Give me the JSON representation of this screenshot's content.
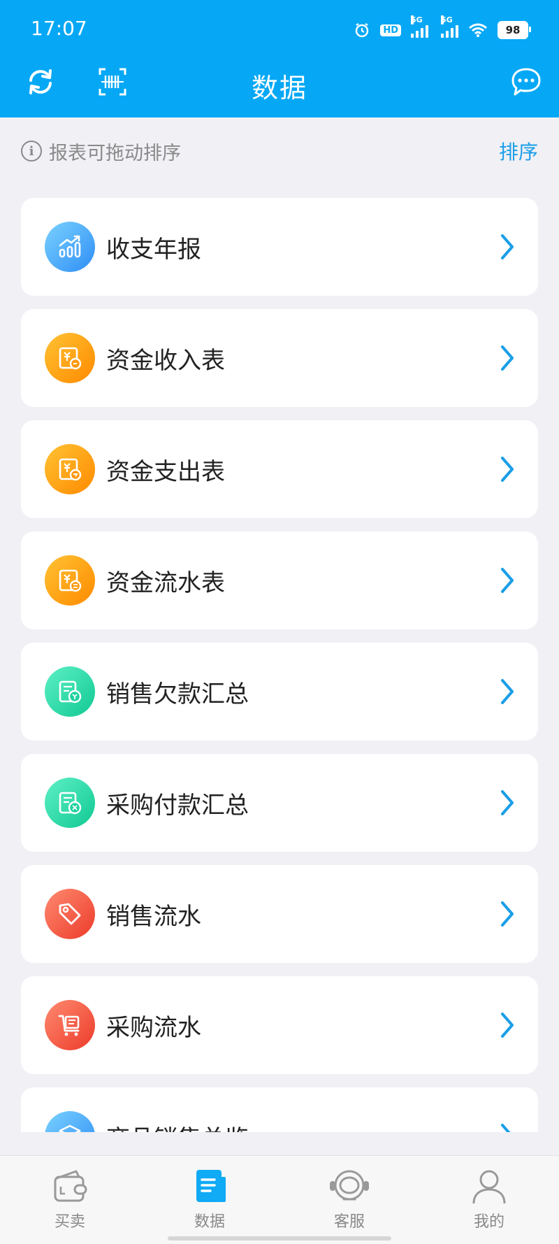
{
  "status_bar": {
    "time": "17:07",
    "hd": "HD",
    "net1": "5G",
    "net2": "5G",
    "battery": "98"
  },
  "header": {
    "title": "数据",
    "left_icon_1": "refresh-icon",
    "left_icon_2": "barcode-scan-icon",
    "right_icon": "message-icon"
  },
  "hint": {
    "text": "报表可拖动排序",
    "sort_label": "排序"
  },
  "reports": [
    {
      "label": "收支年报",
      "icon": "bar-chart-icon",
      "color": "blue"
    },
    {
      "label": "资金收入表",
      "icon": "income-report-icon",
      "color": "orange"
    },
    {
      "label": "资金支出表",
      "icon": "expense-report-icon",
      "color": "orange"
    },
    {
      "label": "资金流水表",
      "icon": "cashflow-report-icon",
      "color": "orange"
    },
    {
      "label": "销售欠款汇总",
      "icon": "sales-debt-icon",
      "color": "green"
    },
    {
      "label": "采购付款汇总",
      "icon": "purchase-payment-icon",
      "color": "green"
    },
    {
      "label": "销售流水",
      "icon": "price-tag-icon",
      "color": "red"
    },
    {
      "label": "采购流水",
      "icon": "shopping-cart-icon",
      "color": "red"
    },
    {
      "label": "商品销售总览",
      "icon": "box-icon",
      "color": "blue"
    }
  ],
  "bottom_nav": [
    {
      "label": "买卖",
      "icon": "wallet-icon"
    },
    {
      "label": "数据",
      "icon": "document-icon"
    },
    {
      "label": "客服",
      "icon": "headset-icon"
    },
    {
      "label": "我的",
      "icon": "user-icon"
    }
  ],
  "colors": {
    "primary": "#06a8f5",
    "link": "#1a9ee8",
    "background": "#f0f0f5"
  }
}
